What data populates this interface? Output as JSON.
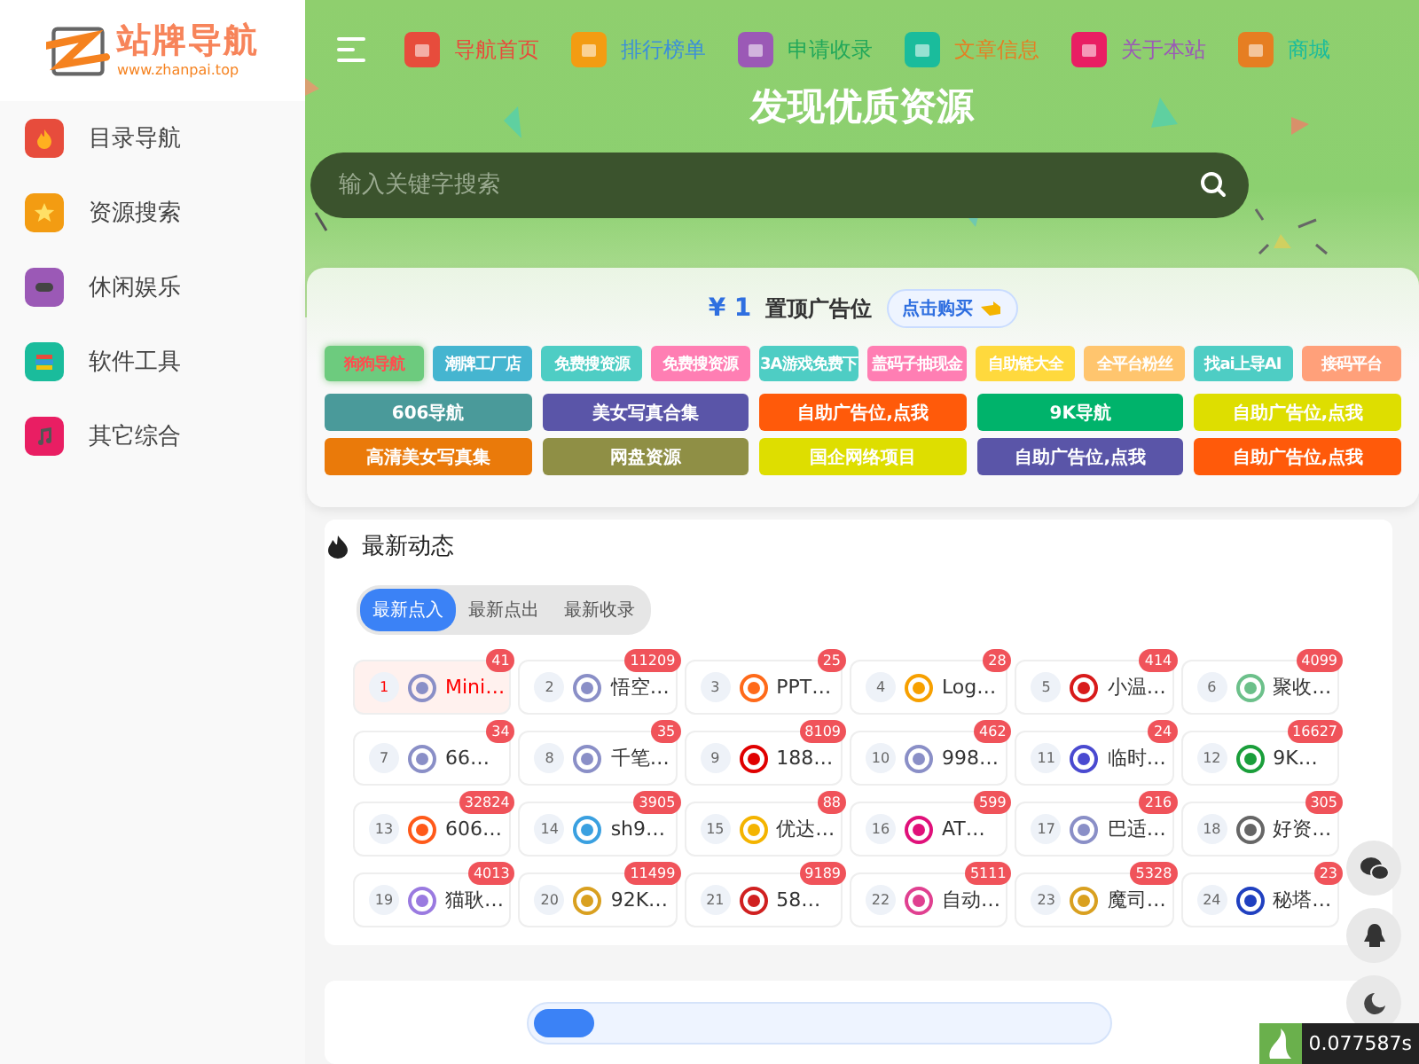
{
  "logo": {
    "title": "站牌导航",
    "url": "www.zhanpai.top"
  },
  "sidebar": {
    "items": [
      {
        "label": "目录导航",
        "color": "#e74c3c",
        "kind": "fire"
      },
      {
        "label": "资源搜索",
        "color": "#f39c12",
        "kind": "star"
      },
      {
        "label": "休闲娱乐",
        "color": "#9b59b6",
        "kind": "gamepad"
      },
      {
        "label": "软件工具",
        "color": "#1abc9c",
        "kind": "books"
      },
      {
        "label": "其它综合",
        "color": "#e91e63",
        "kind": "music"
      }
    ]
  },
  "nav": [
    {
      "label": "导航首页",
      "color": "#e74c3c"
    },
    {
      "label": "排行榜单",
      "color": "#f39c12"
    },
    {
      "label": "申请收录",
      "color": "#9b59b6"
    },
    {
      "label": "文章信息",
      "color": "#1abc9c"
    },
    {
      "label": "关于本站",
      "color": "#e91e63"
    },
    {
      "label": "商城",
      "color": "#e67e22"
    }
  ],
  "hero": {
    "title": "发现优质资源",
    "search": {
      "placeholder": "输入关键字搜索"
    }
  },
  "ads": {
    "price": "¥ 1",
    "title": "置顶广告位",
    "buy_button": "点击购买",
    "tags": [
      {
        "label": "狗狗导航",
        "color": "#6dcb7e",
        "kind": "featured"
      },
      {
        "label": "潮牌工厂店",
        "color": "#45b5d0",
        "kind": "plain"
      },
      {
        "label": "免费搜资源",
        "color": "#4ecdc4",
        "kind": "plain"
      },
      {
        "label": "免费搜资源",
        "color": "#ff7eb3",
        "kind": "plain"
      },
      {
        "label": "3A游戏免费下",
        "color": "#4ecdc4",
        "kind": "plain"
      },
      {
        "label": "盖码子抽现金",
        "color": "#ff7eb3",
        "kind": "plain"
      },
      {
        "label": "自助链大全",
        "color": "#ffd93d",
        "kind": "plain"
      },
      {
        "label": "全平台粉丝",
        "color": "#ffc56e",
        "kind": "plain"
      },
      {
        "label": "找ai上导AI",
        "color": "#4ecdc4",
        "kind": "plain"
      },
      {
        "label": "接码平台",
        "color": "#ffa07a",
        "kind": "plain"
      }
    ],
    "links": [
      {
        "label": "606导航",
        "color": "#4a9a9a"
      },
      {
        "label": "美女写真合集",
        "color": "#5a55a8"
      },
      {
        "label": "自助广告位,点我",
        "color": "#ff5a0a"
      },
      {
        "label": "9K导航",
        "color": "#00b36b"
      },
      {
        "label": "自助广告位,点我",
        "color": "#dede00"
      },
      {
        "label": "高清美女写真集",
        "color": "#ea7a0a"
      },
      {
        "label": "网盘资源",
        "color": "#8f8f45"
      },
      {
        "label": "国企网络项目",
        "color": "#dede00"
      },
      {
        "label": "自助广告位,点我",
        "color": "#5a55a8"
      },
      {
        "label": "自助广告位,点我",
        "color": "#ff5a0a"
      }
    ]
  },
  "latest": {
    "title": "最新动态",
    "tabs": [
      {
        "label": "最新点入",
        "selected": true
      },
      {
        "label": "最新点出",
        "selected": false
      },
      {
        "label": "最新收录",
        "selected": false
      }
    ],
    "items": [
      {
        "rank": "1",
        "name": "Mini…",
        "count": "41",
        "color": "#8a8fc7",
        "selected": true
      },
      {
        "rank": "2",
        "name": "悟空…",
        "count": "11209",
        "color": "#8a8fc7",
        "selected": false
      },
      {
        "rank": "3",
        "name": "PPT…",
        "count": "25",
        "color": "#ff6a1a",
        "selected": false
      },
      {
        "rank": "4",
        "name": "Log…",
        "count": "28",
        "color": "#f7a000",
        "selected": false
      },
      {
        "rank": "5",
        "name": "小温…",
        "count": "414",
        "color": "#d81b1b",
        "selected": false
      },
      {
        "rank": "6",
        "name": "聚收…",
        "count": "4099",
        "color": "#6cc08a",
        "selected": false
      },
      {
        "rank": "7",
        "name": "66…",
        "count": "34",
        "color": "#8a8fc7",
        "selected": false
      },
      {
        "rank": "8",
        "name": "千笔…",
        "count": "35",
        "color": "#8a8fc7",
        "selected": false
      },
      {
        "rank": "9",
        "name": "188…",
        "count": "8109",
        "color": "#e00000",
        "selected": false
      },
      {
        "rank": "10",
        "name": "998…",
        "count": "462",
        "color": "#8a8fc7",
        "selected": false
      },
      {
        "rank": "11",
        "name": "临时…",
        "count": "24",
        "color": "#4a4ad0",
        "selected": false
      },
      {
        "rank": "12",
        "name": "9K…",
        "count": "16627",
        "color": "#1a9e3a",
        "selected": false
      },
      {
        "rank": "13",
        "name": "606…",
        "count": "32824",
        "color": "#ff5a1a",
        "selected": false
      },
      {
        "rank": "14",
        "name": "sh9…",
        "count": "3905",
        "color": "#3aa0e0",
        "selected": false
      },
      {
        "rank": "15",
        "name": "优达…",
        "count": "88",
        "color": "#f4b400",
        "selected": false
      },
      {
        "rank": "16",
        "name": "AT…",
        "count": "599",
        "color": "#e0107a",
        "selected": false
      },
      {
        "rank": "17",
        "name": "巴适…",
        "count": "216",
        "color": "#8a8fc7",
        "selected": false
      },
      {
        "rank": "18",
        "name": "好资…",
        "count": "305",
        "color": "#666666",
        "selected": false
      },
      {
        "rank": "19",
        "name": "猫耿…",
        "count": "4013",
        "color": "#9a7ae0",
        "selected": false
      },
      {
        "rank": "20",
        "name": "92K…",
        "count": "11499",
        "color": "#d9a020",
        "selected": false
      },
      {
        "rank": "21",
        "name": "58…",
        "count": "9189",
        "color": "#d02020",
        "selected": false
      },
      {
        "rank": "22",
        "name": "自动…",
        "count": "5111",
        "color": "#e04090",
        "selected": false
      },
      {
        "rank": "23",
        "name": "魔司…",
        "count": "5328",
        "color": "#d9a020",
        "selected": false
      },
      {
        "rank": "24",
        "name": "秘塔…",
        "count": "23",
        "color": "#2040c0",
        "selected": false
      }
    ]
  },
  "timer": "0.077587s"
}
